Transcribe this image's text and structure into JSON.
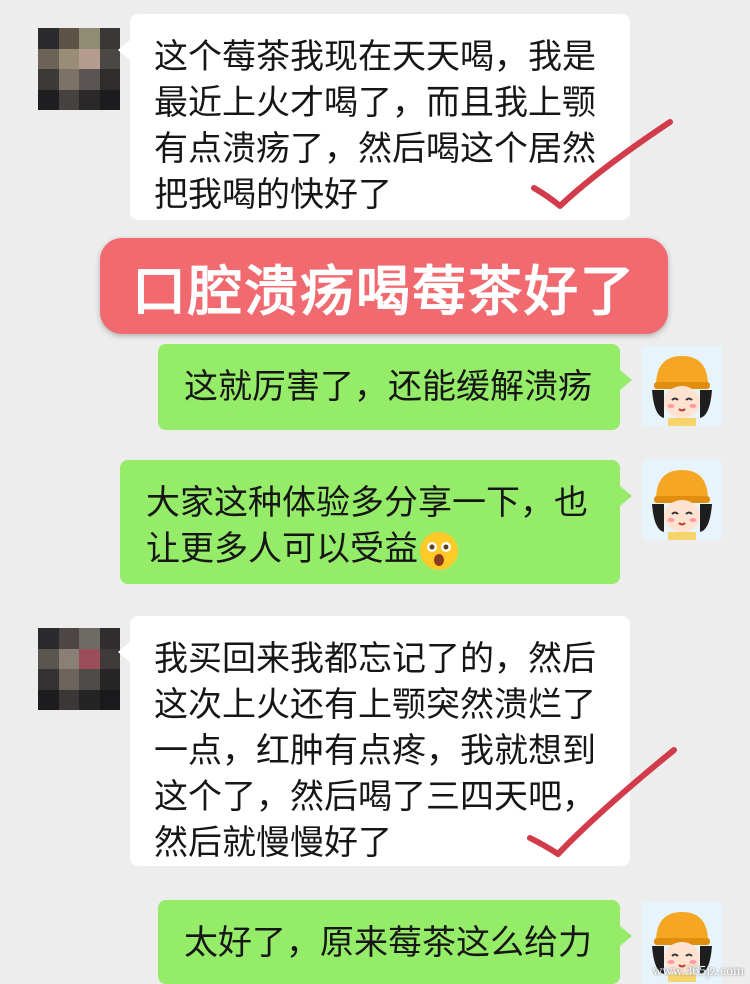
{
  "messages": [
    {
      "side": "in",
      "lines": [
        "这个莓茶我现在天天喝，我是",
        "最近上火才喝了，而且我上颚",
        "有点溃疡了，然后喝这个居然",
        "把我喝的快好了"
      ]
    },
    {
      "side": "out",
      "lines": [
        "这就厉害了，还能缓解溃疡"
      ]
    },
    {
      "side": "out",
      "lines": [
        "大家这种体验多分享一下，也",
        "让更多人可以受益"
      ],
      "emoji": "surprised-face-emoji"
    },
    {
      "side": "in",
      "lines": [
        "我买回来我都忘记了的，然后",
        "这次上火还有上颚突然溃烂了",
        "一点，红肿有点疼，我就想到",
        "这个了，然后喝了三四天吧，",
        "然后就慢慢好了"
      ]
    },
    {
      "side": "out",
      "lines": [
        "太好了，原来莓茶这么给力"
      ]
    }
  ],
  "banner": {
    "text": "口腔溃疡喝莓茶好了"
  },
  "watermark": {
    "text": "www.365jz.com"
  },
  "colors": {
    "background": "#ededed",
    "incoming_bubble": "#ffffff",
    "outgoing_bubble": "#95ec69",
    "banner": "#f06a6f",
    "checkmark": "#d23c4a"
  },
  "icons": {
    "contact_avatar": "blurred-avatar",
    "self_avatar": "cartoon-girl-avatar",
    "checkmark": "red-checkmark-icon"
  }
}
